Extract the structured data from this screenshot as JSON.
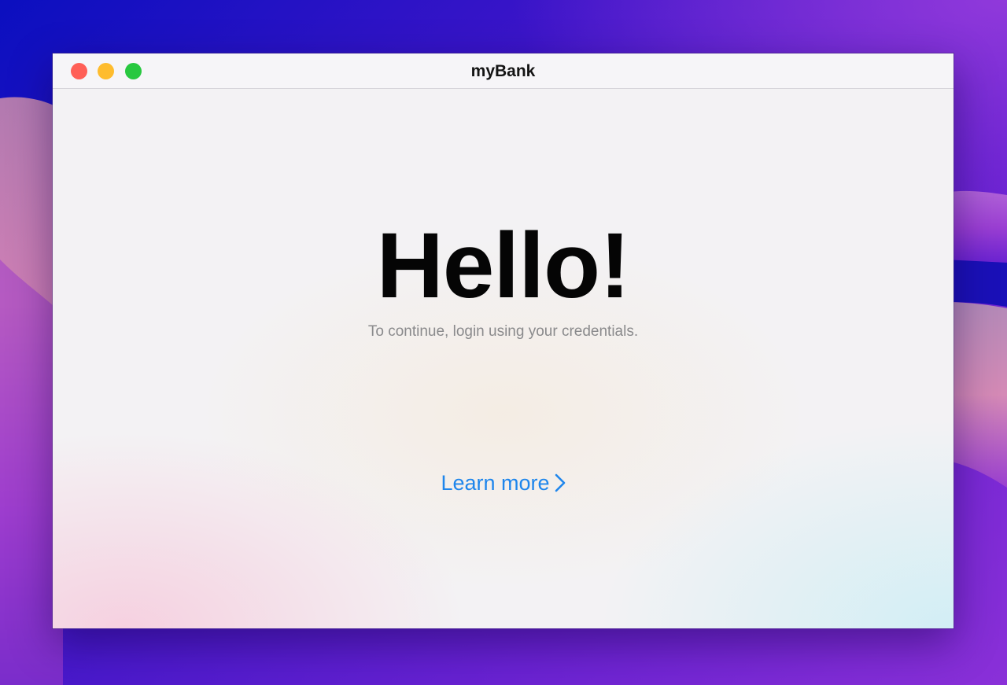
{
  "window": {
    "title": "myBank",
    "controls": [
      {
        "name": "close",
        "color": "#ff5f57"
      },
      {
        "name": "minimize",
        "color": "#febc2e"
      },
      {
        "name": "zoom",
        "color": "#28c840"
      }
    ]
  },
  "main": {
    "heading": "Hello!",
    "subtitle": "To continue, login using your credentials.",
    "link": {
      "label": "Learn more",
      "icon": "chevron-right-icon",
      "color": "#1f86ec"
    }
  }
}
